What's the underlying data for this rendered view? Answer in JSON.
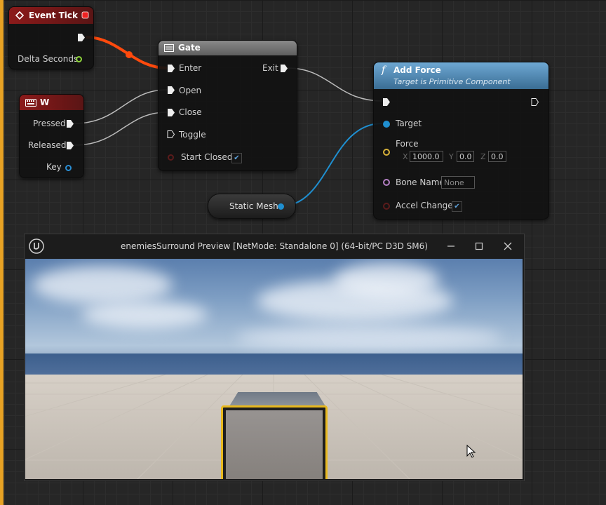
{
  "colors": {
    "exec_wire": "#ff4a0d",
    "data_wire_object": "#1f8fd0",
    "wire_default": "#bbbbbb",
    "event_header": "#8c1a1a",
    "key_header": "#8c1a1a",
    "function_header": "#5f9cc9",
    "gate_header": "#7d7d7d",
    "selection_outline": "#e8b91f",
    "frame_accent": "#e7a224"
  },
  "nodes": {
    "event_tick": {
      "title": "Event Tick",
      "pin_delta_seconds": "Delta Seconds",
      "icon": "event-diamond-icon"
    },
    "w_key": {
      "title": "W",
      "pin_pressed": "Pressed",
      "pin_released": "Released",
      "pin_key": "Key",
      "icon": "keyboard-icon"
    },
    "gate": {
      "title": "Gate",
      "pin_enter": "Enter",
      "pin_open": "Open",
      "pin_close": "Close",
      "pin_toggle": "Toggle",
      "pin_start_closed": "Start Closed",
      "pin_exit": "Exit",
      "start_closed_checked": true,
      "icon": "gate-icon"
    },
    "static_mesh": {
      "label": "Static Mesh"
    },
    "add_force": {
      "title": "Add Force",
      "subtitle": "Target is Primitive Component",
      "pin_target": "Target",
      "pin_force": "Force",
      "force": {
        "x_label": "X",
        "x": "1000.0",
        "y_label": "Y",
        "y": "0.0",
        "z_label": "Z",
        "z": "0.0"
      },
      "pin_bone_name": "Bone Name",
      "bone_name_value": "None",
      "pin_accel_change": "Accel Change",
      "accel_change_checked": true,
      "icon": "function-icon"
    }
  },
  "preview_window": {
    "title": "enemiesSurround Preview [NetMode: Standalone 0]  (64-bit/PC D3D SM6)",
    "logo_icon": "unreal-logo-icon",
    "minimize_icon": "minimize-icon",
    "maximize_icon": "maximize-icon",
    "close_icon": "close-icon"
  }
}
